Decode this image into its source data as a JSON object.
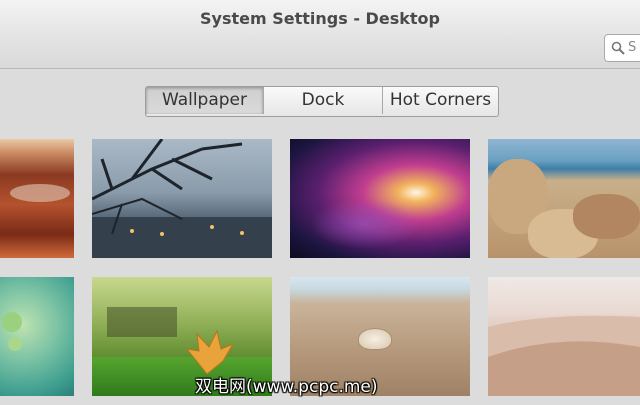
{
  "window": {
    "title": "System Settings - Desktop",
    "search_placeholder": "S"
  },
  "tabs": [
    {
      "label": "Wallpaper",
      "active": true
    },
    {
      "label": "Dock",
      "active": false
    },
    {
      "label": "Hot Corners",
      "active": false
    }
  ],
  "wallpapers": [
    {
      "name": "red canyon rock"
    },
    {
      "name": "winter city with bare branches"
    },
    {
      "name": "purple nebula"
    },
    {
      "name": "rocky seashore"
    },
    {
      "name": "green leaves bokeh"
    },
    {
      "name": "autumn leaf on grass"
    },
    {
      "name": "seashell on sand"
    },
    {
      "name": "desert dunes"
    }
  ],
  "watermark": "双电网(www.pcpc.me)"
}
